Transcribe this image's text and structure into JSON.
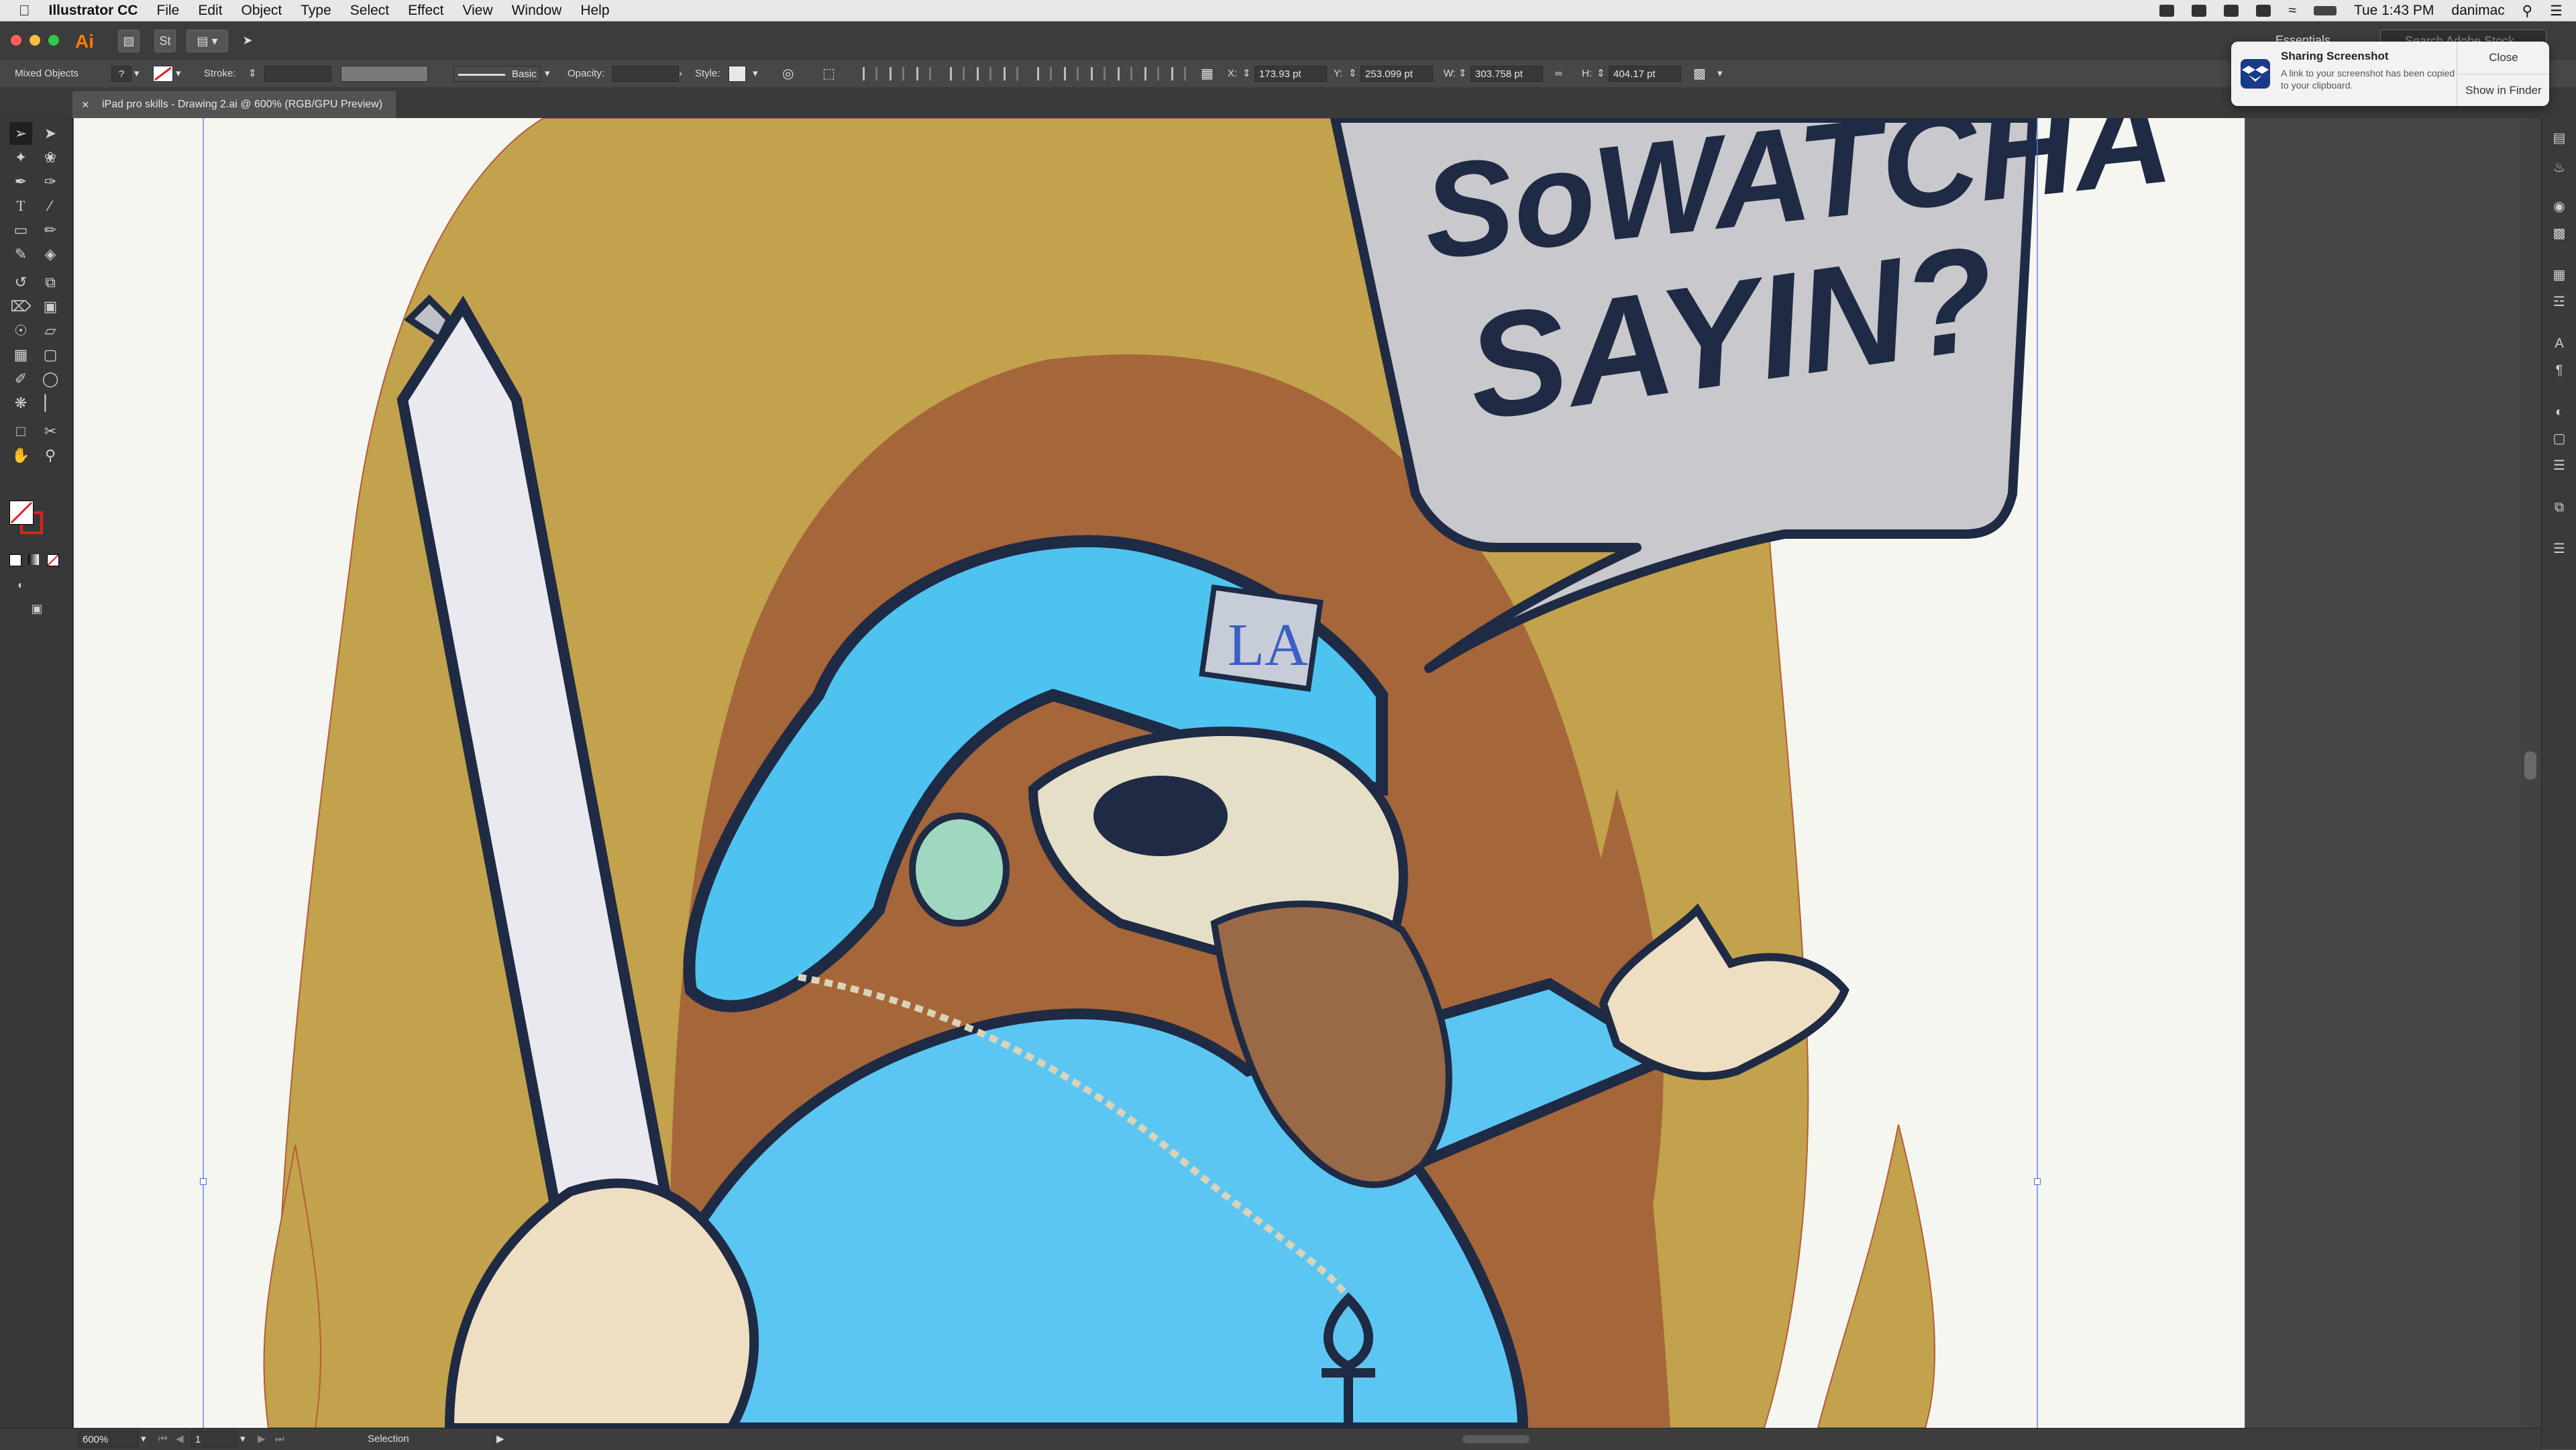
{
  "menubar": {
    "app_name": "Illustrator CC",
    "items": [
      "File",
      "Edit",
      "Object",
      "Type",
      "Select",
      "Effect",
      "View",
      "Window",
      "Help"
    ],
    "clock": "Tue 1:43 PM",
    "user": "danimac"
  },
  "appbar": {
    "logo": "Ai",
    "workspace": "Essentials",
    "search_placeholder": "Search Adobe Stock"
  },
  "control_bar": {
    "selection_type": "Mixed Objects",
    "stroke_label": "Stroke:",
    "brush_label": "Basic",
    "opacity_label": "Opacity:",
    "style_label": "Style:",
    "x_label": "X:",
    "x_value": "173.93 pt",
    "y_label": "Y:",
    "y_value": "253.099 pt",
    "w_label": "W:",
    "w_value": "303.758 pt",
    "h_label": "H:",
    "h_value": "404.17 pt"
  },
  "document_tab": {
    "title": "iPad pro skills - Drawing 2.ai @ 600% (RGB/GPU Preview)",
    "close": "×"
  },
  "artwork": {
    "speech_line1": "SoWATCHA",
    "speech_line2": "SAYIN?",
    "cap_text": "LA"
  },
  "statusbar": {
    "zoom": "600%",
    "artboard_number": "1",
    "tool_name": "Selection"
  },
  "notification": {
    "title": "Sharing Screenshot",
    "body": "A link to your screenshot has been copied to your clipboard.",
    "close_label": "Close",
    "finder_label": "Show in Finder"
  },
  "colors": {
    "cap_blue": "#4fc3f0",
    "shirt_blue": "#5cc6f2",
    "flame_gold": "#c2a24c",
    "flame_brown": "#a5663a",
    "outline": "#1f2a44",
    "bubble": "#c9c8cc"
  }
}
